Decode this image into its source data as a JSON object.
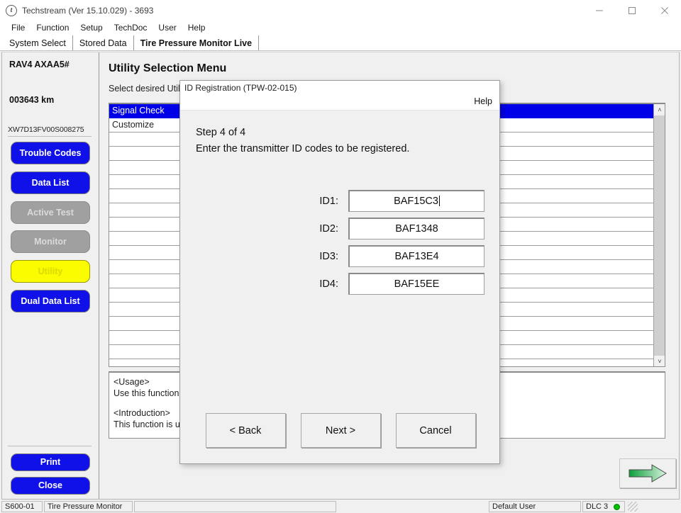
{
  "window": {
    "title": "Techstream (Ver 15.10.029) - 3693",
    "app_icon": "techstream-icon",
    "minimize_label": "—",
    "maximize_label": "□",
    "close_label": "×"
  },
  "menu": {
    "items": [
      "File",
      "Function",
      "Setup",
      "TechDoc",
      "User",
      "Help"
    ]
  },
  "tabs": [
    {
      "label": "System Select",
      "active": false
    },
    {
      "label": "Stored Data",
      "active": false
    },
    {
      "label": "Tire Pressure Monitor Live",
      "active": true
    }
  ],
  "sidebar": {
    "vehicle_model": "RAV4 AXAA5#",
    "odometer": "003643 km",
    "vin": "XW7D13FV00S008275",
    "buttons": [
      {
        "label": "Trouble Codes",
        "state": "enabled"
      },
      {
        "label": "Data List",
        "state": "enabled"
      },
      {
        "label": "Active Test",
        "state": "disabled"
      },
      {
        "label": "Monitor",
        "state": "disabled"
      },
      {
        "label": "Utility",
        "state": "selected"
      },
      {
        "label": "Dual Data List",
        "state": "enabled"
      }
    ],
    "bottom_buttons": [
      {
        "label": "Print"
      },
      {
        "label": "Close"
      }
    ]
  },
  "main": {
    "title": "Utility Selection Menu",
    "subtitle": "Select desired Utility.",
    "list": {
      "rows": [
        {
          "label": "Signal Check",
          "selected": true
        },
        {
          "label": "Customize",
          "selected": false
        },
        {
          "label": "",
          "selected": false
        },
        {
          "label": "",
          "selected": false
        },
        {
          "label": "",
          "selected": false
        },
        {
          "label": "",
          "selected": false
        },
        {
          "label": "",
          "selected": false
        },
        {
          "label": "",
          "selected": false
        },
        {
          "label": "",
          "selected": false
        },
        {
          "label": "",
          "selected": false
        },
        {
          "label": "",
          "selected": false
        },
        {
          "label": "",
          "selected": false
        },
        {
          "label": "",
          "selected": false
        },
        {
          "label": "",
          "selected": false
        },
        {
          "label": "",
          "selected": false
        },
        {
          "label": "",
          "selected": false
        },
        {
          "label": "",
          "selected": false
        },
        {
          "label": "",
          "selected": false
        }
      ],
      "scroll_up": "˄",
      "scroll_down": "˅"
    },
    "usage": {
      "usage_heading": "<Usage>",
      "usage_text": "Use this function",
      "intro_heading": "<Introduction>",
      "intro_text": "This function is us"
    },
    "next_arrow": "green-arrow-right-icon"
  },
  "dialog": {
    "title": "ID Registration (TPW-02-015)",
    "help_label": "Help",
    "step_line1": "Step 4 of 4",
    "step_line2": "Enter the transmitter ID codes to be registered.",
    "fields": [
      {
        "label": "ID1:",
        "value": "BAF15C3",
        "focused": true
      },
      {
        "label": "ID2:",
        "value": "BAF1348",
        "focused": false
      },
      {
        "label": "ID3:",
        "value": "BAF13E4",
        "focused": false
      },
      {
        "label": "ID4:",
        "value": "BAF15EE",
        "focused": false
      }
    ],
    "buttons": [
      {
        "label": "< Back"
      },
      {
        "label": "Next >"
      },
      {
        "label": "Cancel"
      }
    ]
  },
  "statusbar": {
    "code": "S600-01",
    "system": "Tire Pressure Monitor",
    "blank": "",
    "user": "Default User",
    "dlc": "DLC 3",
    "dlc_color": "#00c000"
  }
}
